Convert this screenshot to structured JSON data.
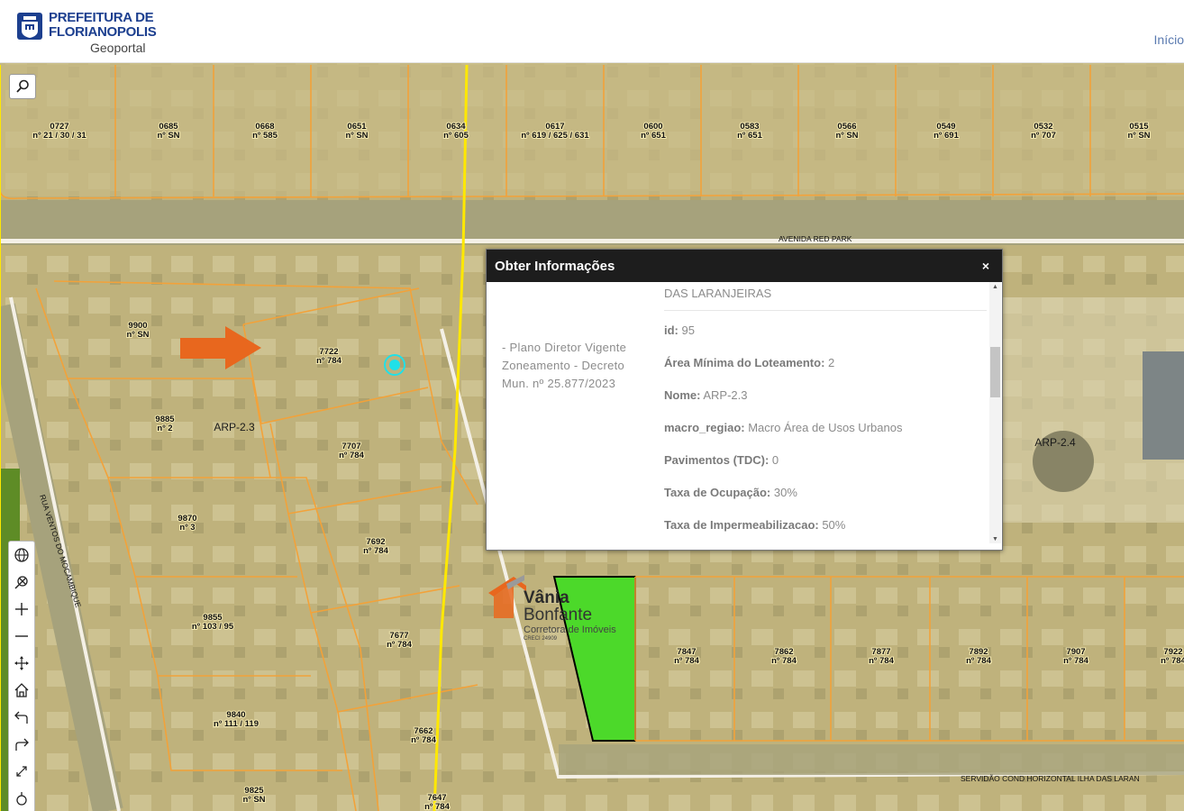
{
  "header": {
    "brand_line1": "PREFEITURA DE",
    "brand_line2": "FLORIANOPOLIS",
    "brand_line3": "Geoportal",
    "nav_home": "Início"
  },
  "colors": {
    "brand_blue": "#1c3f8f",
    "lot_outline": "#f2a23a",
    "zone_line": "#ffe800",
    "highlight_arrow": "#e8671e",
    "selected_marker": "#20e0e8",
    "popup_header": "#1d1d1d"
  },
  "map": {
    "lots": [
      {
        "id": "0727",
        "num": "nº 21 / 30 / 31"
      },
      {
        "id": "0685",
        "num": "nº SN"
      },
      {
        "id": "0668",
        "num": "nº 585"
      },
      {
        "id": "0651",
        "num": "nº SN"
      },
      {
        "id": "0634",
        "num": "nº 605"
      },
      {
        "id": "0617",
        "num": "nº 619 / 625 / 631"
      },
      {
        "id": "0600",
        "num": "nº 651"
      },
      {
        "id": "0583",
        "num": "nº 651"
      },
      {
        "id": "0566",
        "num": "nº SN"
      },
      {
        "id": "0549",
        "num": "nº 691"
      },
      {
        "id": "0532",
        "num": "nº 707"
      },
      {
        "id": "0515",
        "num": "nº SN"
      },
      {
        "id": "9900",
        "num": "nº SN"
      },
      {
        "id": "7722",
        "num": "nº 784"
      },
      {
        "id": "9885",
        "num": "nº 2"
      },
      {
        "id": "7707",
        "num": "nº 784"
      },
      {
        "id": "9870",
        "num": "nº 3"
      },
      {
        "id": "7692",
        "num": "nº 784"
      },
      {
        "id": "9855",
        "num": "nº 103 / 95"
      },
      {
        "id": "7677",
        "num": "nº 784"
      },
      {
        "id": "9840",
        "num": "nº 111 / 119"
      },
      {
        "id": "7662",
        "num": "nº 784"
      },
      {
        "id": "9825",
        "num": "nº SN"
      },
      {
        "id": "7647",
        "num": "nº 784"
      },
      {
        "id": "7847",
        "num": "nº 784"
      },
      {
        "id": "7862",
        "num": "nº 784"
      },
      {
        "id": "7877",
        "num": "nº 784"
      },
      {
        "id": "7892",
        "num": "nº 784"
      },
      {
        "id": "7907",
        "num": "nº 784"
      },
      {
        "id": "7922",
        "num": "nº 784"
      }
    ],
    "zones": [
      "ARP-2.3",
      "ARP-2.4"
    ],
    "streets": {
      "avenida": "AVENIDA RED PARK",
      "rua": "RUA VENTOS DO MOCAMBIQUE",
      "servidao": "SERVIDÃO COND HORIZONTAL ILHA DAS LARAN"
    }
  },
  "popup": {
    "title": "Obter Informações",
    "close": "×",
    "left_text": "- Plano Diretor Vigente Zoneamento - Decreto Mun. nº 25.877/2023",
    "prev_row": "Nome Logradouro: SERVIDAO COND HORIZONTAL ILHA DAS LARANJEIRAS",
    "props": [
      {
        "key": "id:",
        "value": "95"
      },
      {
        "key": "Área Mínima do Loteamento:",
        "value": "2"
      },
      {
        "key": "Nome:",
        "value": "ARP-2.3"
      },
      {
        "key": "macro_regiao:",
        "value": "Macro Área de Usos Urbanos"
      },
      {
        "key": "Pavimentos (TDC):",
        "value": "0"
      },
      {
        "key": "Taxa de Ocupação:",
        "value": "30%"
      },
      {
        "key": "Taxa de Impermeabilizacao:",
        "value": "50%"
      }
    ]
  },
  "toolbar": {
    "icons": [
      "globe-icon",
      "clear-selection-icon",
      "zoom-in-icon",
      "zoom-out-icon",
      "pan-icon",
      "home-icon",
      "back-icon",
      "forward-icon",
      "fullscreen-icon",
      "locate-icon"
    ]
  },
  "watermark": {
    "name_bold": "Vânia",
    "name_rest": " Bonfante",
    "subtitle": "Corretora de Imóveis",
    "creci": "CRECI 24909"
  }
}
